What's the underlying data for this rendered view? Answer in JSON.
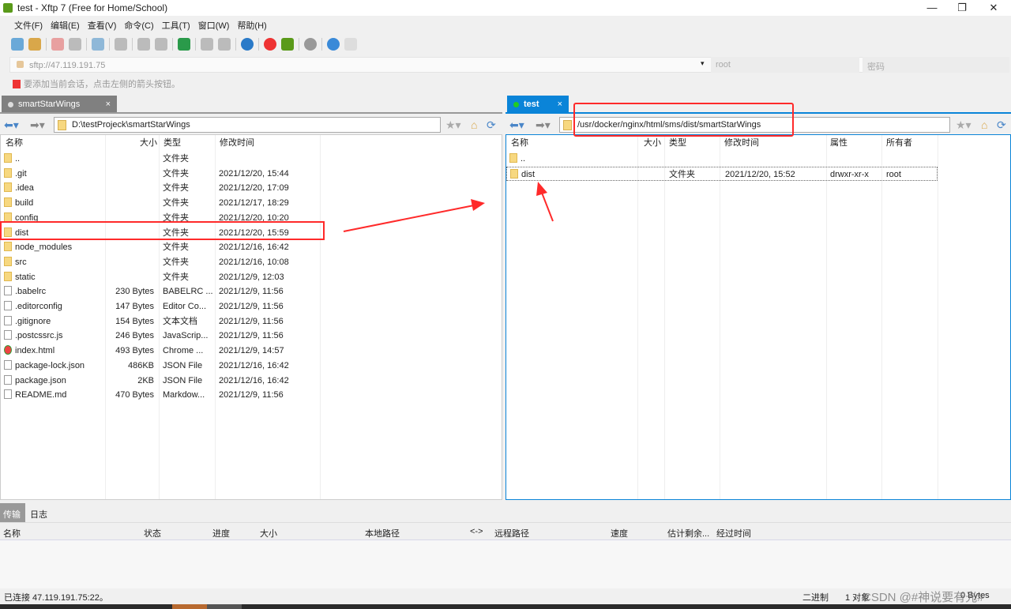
{
  "window": {
    "title": "test - Xftp 7 (Free for Home/School)",
    "minimize": "—",
    "restore": "❐",
    "close": "✕"
  },
  "menu": [
    "文件(F)",
    "编辑(E)",
    "查看(V)",
    "命令(C)",
    "工具(T)",
    "窗口(W)",
    "帮助(H)"
  ],
  "address": {
    "url": "sftp://47.119.191.75",
    "user": "root",
    "password_placeholder": "密码"
  },
  "hint": "要添加当前会话，点击左侧的箭头按钮。",
  "left": {
    "tab": "smartStarWings",
    "tab_close": "×",
    "path": "D:\\testProjeck\\smartStarWings",
    "columns": [
      "名称",
      "大小",
      "类型",
      "修改时间"
    ],
    "files": [
      {
        "name": "..",
        "size": "",
        "type": "文件夹",
        "date": "",
        "icon": "folder"
      },
      {
        "name": ".git",
        "size": "",
        "type": "文件夹",
        "date": "2021/12/20, 15:44",
        "icon": "folder"
      },
      {
        "name": ".idea",
        "size": "",
        "type": "文件夹",
        "date": "2021/12/20, 17:09",
        "icon": "folder"
      },
      {
        "name": "build",
        "size": "",
        "type": "文件夹",
        "date": "2021/12/17, 18:29",
        "icon": "folder"
      },
      {
        "name": "config",
        "size": "",
        "type": "文件夹",
        "date": "2021/12/20, 10:20",
        "icon": "folder"
      },
      {
        "name": "dist",
        "size": "",
        "type": "文件夹",
        "date": "2021/12/20, 15:59",
        "icon": "folder"
      },
      {
        "name": "node_modules",
        "size": "",
        "type": "文件夹",
        "date": "2021/12/16, 16:42",
        "icon": "folder"
      },
      {
        "name": "src",
        "size": "",
        "type": "文件夹",
        "date": "2021/12/16, 10:08",
        "icon": "folder"
      },
      {
        "name": "static",
        "size": "",
        "type": "文件夹",
        "date": "2021/12/9, 12:03",
        "icon": "folder"
      },
      {
        "name": ".babelrc",
        "size": "230 Bytes",
        "type": "BABELRC ...",
        "date": "2021/12/9, 11:56",
        "icon": "file"
      },
      {
        "name": ".editorconfig",
        "size": "147 Bytes",
        "type": "Editor Co...",
        "date": "2021/12/9, 11:56",
        "icon": "file"
      },
      {
        "name": ".gitignore",
        "size": "154 Bytes",
        "type": "文本文档",
        "date": "2021/12/9, 11:56",
        "icon": "file"
      },
      {
        "name": ".postcssrc.js",
        "size": "246 Bytes",
        "type": "JavaScrip...",
        "date": "2021/12/9, 11:56",
        "icon": "file"
      },
      {
        "name": "index.html",
        "size": "493 Bytes",
        "type": "Chrome ...",
        "date": "2021/12/9, 14:57",
        "icon": "chrome"
      },
      {
        "name": "package-lock.json",
        "size": "486KB",
        "type": "JSON File",
        "date": "2021/12/16, 16:42",
        "icon": "file"
      },
      {
        "name": "package.json",
        "size": "2KB",
        "type": "JSON File",
        "date": "2021/12/16, 16:42",
        "icon": "file"
      },
      {
        "name": "README.md",
        "size": "470 Bytes",
        "type": "Markdow...",
        "date": "2021/12/9, 11:56",
        "icon": "file"
      }
    ]
  },
  "right": {
    "tab": "test",
    "tab_close": "×",
    "path": "/usr/docker/nginx/html/sms/dist/smartStarWings",
    "columns": [
      "名称",
      "大小",
      "类型",
      "修改时间",
      "属性",
      "所有者"
    ],
    "files": [
      {
        "name": "..",
        "size": "",
        "type": "",
        "date": "",
        "attr": "",
        "owner": ""
      },
      {
        "name": "dist",
        "size": "",
        "type": "文件夹",
        "date": "2021/12/20, 15:52",
        "attr": "drwxr-xr-x",
        "owner": "root"
      }
    ]
  },
  "bottom": {
    "tabs": [
      "传输",
      "日志"
    ],
    "columns": [
      "名称",
      "状态",
      "进度",
      "大小",
      "本地路径",
      "<->",
      "远程路径",
      "速度",
      "估计剩余...",
      "经过时间"
    ]
  },
  "status": {
    "connected": "已连接 47.119.191.75:22。",
    "mode": "二进制",
    "objects": "1 对象",
    "size": "0 Bytes"
  },
  "watermark": "CSDN @#神说要有光#",
  "colors": {
    "accent": "#0a84d8",
    "annotation": "#ff2a2a"
  }
}
